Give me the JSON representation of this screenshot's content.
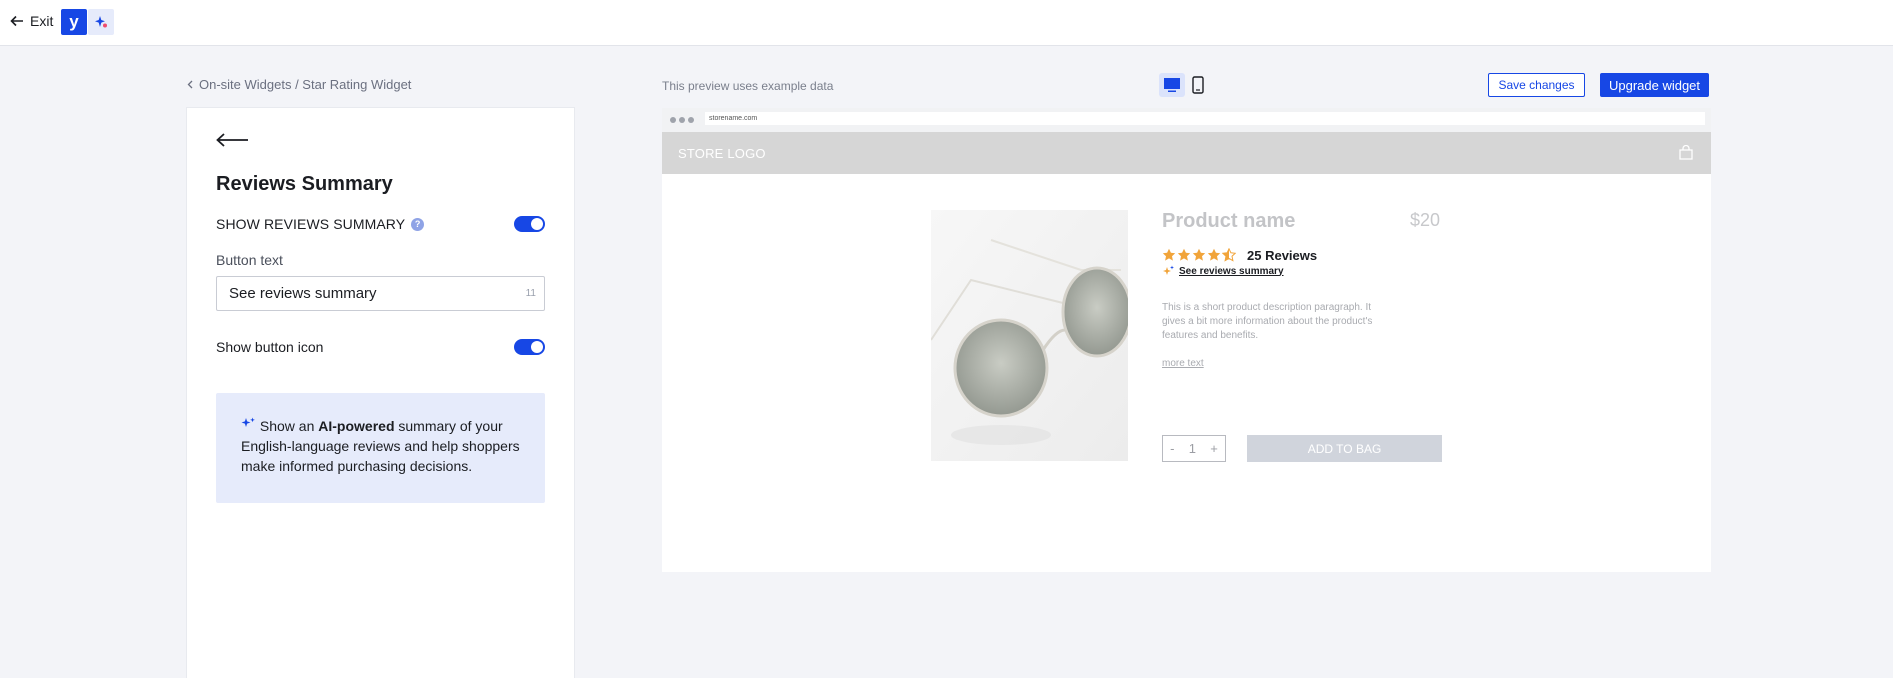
{
  "topbar": {
    "exit_label": "Exit",
    "logo_letter": "y"
  },
  "breadcrumb": "On-site Widgets / Star Rating Widget",
  "preview_note": "This preview uses example data",
  "actions": {
    "save_label": "Save changes",
    "upgrade_label": "Upgrade widget"
  },
  "panel": {
    "title": "Reviews Summary",
    "show_summary_label": "SHOW REVIEWS SUMMARY",
    "show_summary_enabled": true,
    "button_text_label": "Button text",
    "button_text_value": "See reviews summary",
    "button_text_count": "11",
    "show_icon_label": "Show button icon",
    "show_icon_enabled": true,
    "info": {
      "prefix": "Show an ",
      "bold": "AI-powered",
      "suffix": " summary of your English-language reviews and help shoppers make informed purchasing decisions."
    }
  },
  "preview": {
    "url": "storename.com",
    "store_logo": "STORE LOGO",
    "product_name": "Product name",
    "price": "$20",
    "rating": 4.5,
    "reviews_label": "25 Reviews",
    "see_summary_label": "See reviews summary",
    "description": "This is a short product description paragraph. It gives a bit more information about the product's features and benefits.",
    "more_text": "more text",
    "qty_minus": "-",
    "qty_value": "1",
    "qty_plus": "+",
    "add_to_bag": "ADD TO BAG"
  },
  "colors": {
    "accent": "#1747e5",
    "star": "#f1a43a",
    "info_bg": "#e6ebfb"
  }
}
